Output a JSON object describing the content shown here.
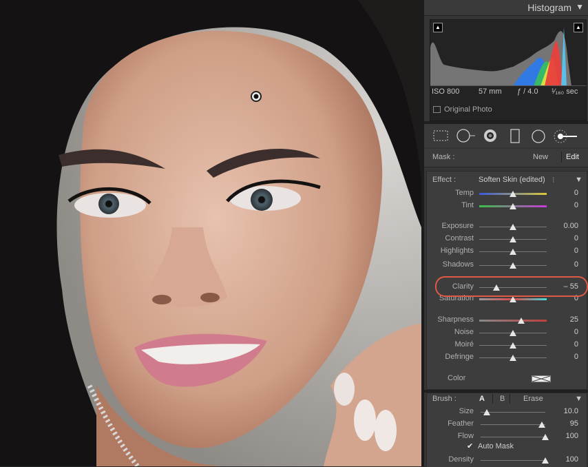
{
  "histogram": {
    "title": "Histogram",
    "collapse_icon": "triangle-down-icon",
    "exif": {
      "iso": "ISO 800",
      "focal": "57 mm",
      "aperture": "ƒ / 4.0",
      "shutter": "¹⁄₁₆₀ sec"
    },
    "original_photo_label": "Original Photo"
  },
  "tools": [
    "crop-overlay-icon",
    "spot-removal-icon",
    "red-eye-icon",
    "graduated-filter-icon",
    "radial-filter-icon",
    "adjustment-brush-icon"
  ],
  "mask": {
    "label": "Mask :",
    "new": "New",
    "edit": "Edit"
  },
  "effect": {
    "label": "Effect :",
    "value": "Soften Skin (edited)",
    "sliders": [
      {
        "key": "temp",
        "label": "Temp",
        "value": "0",
        "pos": 0.5,
        "track": "temp"
      },
      {
        "key": "tint",
        "label": "Tint",
        "value": "0",
        "pos": 0.5,
        "track": "tint"
      },
      {
        "key": "exposure",
        "label": "Exposure",
        "value": "0.00",
        "pos": 0.5
      },
      {
        "key": "contrast",
        "label": "Contrast",
        "value": "0",
        "pos": 0.5
      },
      {
        "key": "highlights",
        "label": "Highlights",
        "value": "0",
        "pos": 0.5
      },
      {
        "key": "shadows",
        "label": "Shadows",
        "value": "0",
        "pos": 0.5
      },
      {
        "key": "clarity",
        "label": "Clarity",
        "value": "– 55",
        "pos": 0.25
      },
      {
        "key": "saturation",
        "label": "Saturation",
        "value": "0",
        "pos": 0.5,
        "track": "sat"
      },
      {
        "key": "sharpness",
        "label": "Sharpness",
        "value": "25",
        "pos": 0.62,
        "track": "sharp"
      },
      {
        "key": "noise",
        "label": "Noise",
        "value": "0",
        "pos": 0.5
      },
      {
        "key": "moire",
        "label": "Moiré",
        "value": "0",
        "pos": 0.5
      },
      {
        "key": "defringe",
        "label": "Defringe",
        "value": "0",
        "pos": 0.5
      }
    ],
    "color_label": "Color"
  },
  "brush": {
    "label": "Brush :",
    "a": "A",
    "b": "B",
    "erase": "Erase",
    "sliders": [
      {
        "key": "size",
        "label": "Size",
        "value": "10.0",
        "pos": 0.1
      },
      {
        "key": "feather",
        "label": "Feather",
        "value": "95",
        "pos": 0.95
      },
      {
        "key": "flow",
        "label": "Flow",
        "value": "100",
        "pos": 1.0
      }
    ],
    "auto_mask": "Auto Mask",
    "density": {
      "key": "density",
      "label": "Density",
      "value": "100",
      "pos": 1.0
    }
  },
  "colors": {
    "accent_ring": "#e05a45",
    "panel": "#353535"
  }
}
